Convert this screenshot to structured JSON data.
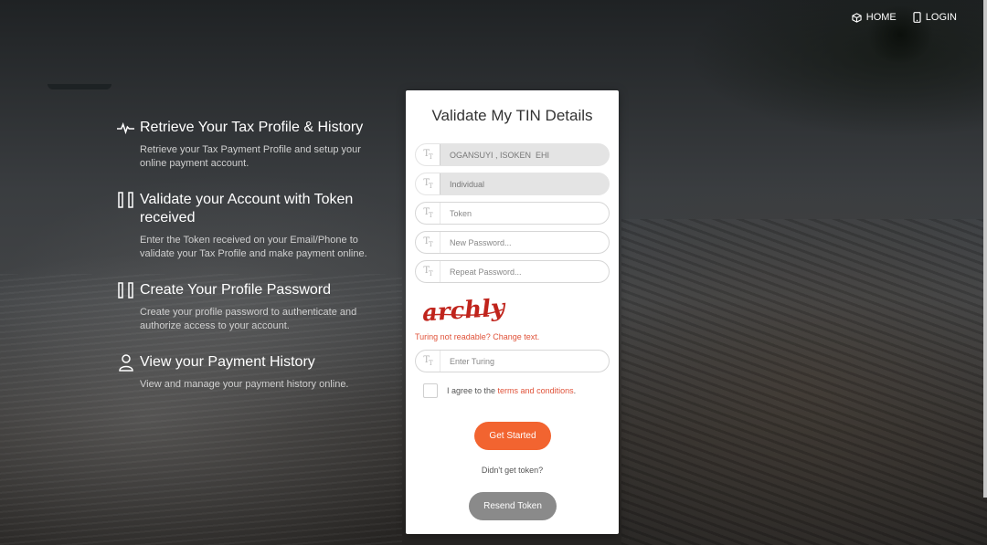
{
  "nav": {
    "home_label": "HOME",
    "login_label": "LOGIN"
  },
  "features": [
    {
      "icon": "pulse-icon",
      "title": "Retrieve Your Tax Profile & History",
      "description": "Retrieve your Tax Payment Profile and setup your online payment account."
    },
    {
      "icon": "token-bars-icon",
      "title": "Validate your Account with Token received",
      "description": "Enter the Token received on your Email/Phone to validate your Tax Profile and make payment online."
    },
    {
      "icon": "token-bars-icon",
      "title": "Create Your Profile Password",
      "description": "Create your profile password to authenticate and authorize access to your account."
    },
    {
      "icon": "user-icon",
      "title": "View your Payment History",
      "description": "View and manage your payment history online."
    }
  ],
  "form": {
    "title": "Validate My TIN Details",
    "name_value": "OGANSUYI , ISOKEN  EHI",
    "type_value": "Individual",
    "token_placeholder": "Token",
    "new_password_placeholder": "New Password...",
    "repeat_password_placeholder": "Repeat Password...",
    "captcha_text": "archly",
    "captcha_link": "Turing not readable? Change text.",
    "turing_placeholder": "Enter Turing",
    "agree_prefix": "I agree to the ",
    "agree_link": "terms and conditions",
    "agree_suffix": ".",
    "submit_label": "Get Started",
    "no_token_text": "Didn't get token?",
    "resend_label": "Resend Token"
  },
  "colors": {
    "accent": "#f26430",
    "link": "#e0533a",
    "resend": "#8a8a8a"
  }
}
